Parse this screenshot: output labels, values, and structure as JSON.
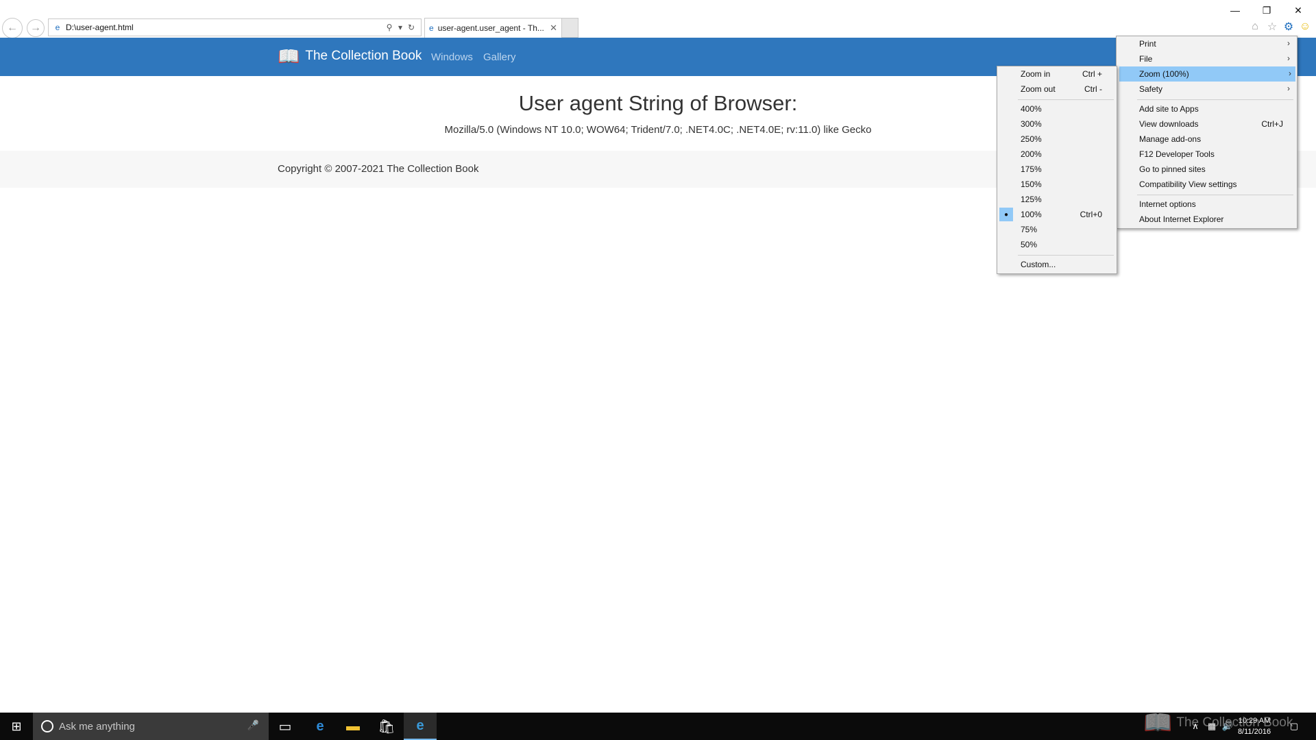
{
  "browser": {
    "address": "D:\\user-agent.html",
    "tab_title": "user-agent.user_agent - Th...",
    "window_controls": {
      "minimize": "—",
      "restore": "❐",
      "close": "✕"
    }
  },
  "site": {
    "brand": "The Collection Book",
    "nav": [
      "Windows",
      "Gallery"
    ],
    "heading": "User agent String of Browser:",
    "user_agent": "Mozilla/5.0 (Windows NT 10.0; WOW64; Trident/7.0; .NET4.0C; .NET4.0E; rv:11.0) like Gecko",
    "footer": "Copyright © 2007-2021 The Collection Book"
  },
  "tools_menu": {
    "items": [
      {
        "label": "Print",
        "submenu": true
      },
      {
        "label": "File",
        "submenu": true
      },
      {
        "label": "Zoom (100%)",
        "submenu": true,
        "highlighted": true
      },
      {
        "label": "Safety",
        "submenu": true
      },
      {
        "label": "Add site to Apps"
      },
      {
        "label": "View downloads",
        "shortcut": "Ctrl+J"
      },
      {
        "label": "Manage add-ons"
      },
      {
        "label": "F12 Developer Tools"
      },
      {
        "label": "Go to pinned sites"
      },
      {
        "label": "Compatibility View settings"
      },
      {
        "label": "Internet options"
      },
      {
        "label": "About Internet Explorer"
      }
    ]
  },
  "zoom_menu": {
    "zoom_in": {
      "label": "Zoom in",
      "shortcut": "Ctrl +"
    },
    "zoom_out": {
      "label": "Zoom out",
      "shortcut": "Ctrl -"
    },
    "levels": [
      "400%",
      "300%",
      "250%",
      "200%",
      "175%",
      "150%",
      "125%",
      "100%",
      "75%",
      "50%"
    ],
    "selected": "100%",
    "selected_shortcut": "Ctrl+0",
    "custom": "Custom..."
  },
  "taskbar": {
    "search_placeholder": "Ask me anything",
    "time": "10:29 AM",
    "date": "8/11/2016",
    "watermark": "The Collection Book"
  }
}
